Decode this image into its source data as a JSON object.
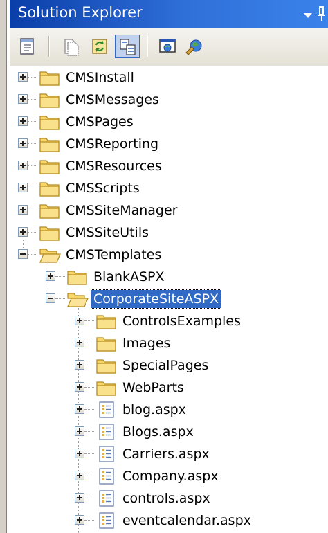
{
  "panel": {
    "title": "Solution Explorer"
  },
  "toolbar": {
    "buttons": [
      {
        "name": "properties-button",
        "icon": "properties-icon"
      },
      {
        "name": "show-all-files-button",
        "icon": "show-all-files-icon"
      },
      {
        "name": "refresh-button",
        "icon": "refresh-icon"
      },
      {
        "name": "nest-related-files-button",
        "icon": "nest-related-files-icon",
        "pressed": true
      },
      {
        "name": "view-in-browser-button",
        "icon": "view-in-browser-icon"
      },
      {
        "name": "copy-website-button",
        "icon": "copy-website-icon"
      }
    ]
  },
  "tree": {
    "items": [
      {
        "label": "CMSInstall",
        "type": "folder",
        "level": 0,
        "expanded": false
      },
      {
        "label": "CMSMessages",
        "type": "folder",
        "level": 0,
        "expanded": false
      },
      {
        "label": "CMSPages",
        "type": "folder",
        "level": 0,
        "expanded": false
      },
      {
        "label": "CMSReporting",
        "type": "folder",
        "level": 0,
        "expanded": false
      },
      {
        "label": "CMSResources",
        "type": "folder",
        "level": 0,
        "expanded": false
      },
      {
        "label": "CMSScripts",
        "type": "folder",
        "level": 0,
        "expanded": false
      },
      {
        "label": "CMSSiteManager",
        "type": "folder",
        "level": 0,
        "expanded": false
      },
      {
        "label": "CMSSiteUtils",
        "type": "folder",
        "level": 0,
        "expanded": false
      },
      {
        "label": "CMSTemplates",
        "type": "folder-open",
        "level": 0,
        "expanded": true
      },
      {
        "label": "BlankASPX",
        "type": "folder",
        "level": 1,
        "expanded": false
      },
      {
        "label": "CorporateSiteASPX",
        "type": "folder-open",
        "level": 1,
        "expanded": true,
        "selected": true
      },
      {
        "label": "ControlsExamples",
        "type": "folder",
        "level": 2,
        "expanded": false
      },
      {
        "label": "Images",
        "type": "folder",
        "level": 2,
        "expanded": false
      },
      {
        "label": "SpecialPages",
        "type": "folder",
        "level": 2,
        "expanded": false
      },
      {
        "label": "WebParts",
        "type": "folder",
        "level": 2,
        "expanded": false
      },
      {
        "label": "blog.aspx",
        "type": "aspx",
        "level": 2,
        "expanded": false
      },
      {
        "label": "Blogs.aspx",
        "type": "aspx",
        "level": 2,
        "expanded": false
      },
      {
        "label": "Carriers.aspx",
        "type": "aspx",
        "level": 2,
        "expanded": false
      },
      {
        "label": "Company.aspx",
        "type": "aspx",
        "level": 2,
        "expanded": false
      },
      {
        "label": "controls.aspx",
        "type": "aspx",
        "level": 2,
        "expanded": false
      },
      {
        "label": "eventcalendar.aspx",
        "type": "aspx",
        "level": 2,
        "expanded": false
      }
    ]
  },
  "colors": {
    "title_bar_start": "#0a3ea8",
    "title_bar_end": "#3a83ea",
    "selection": "#316ac5",
    "folder": "#f6d66a",
    "toolbar": "#ece9d8"
  }
}
